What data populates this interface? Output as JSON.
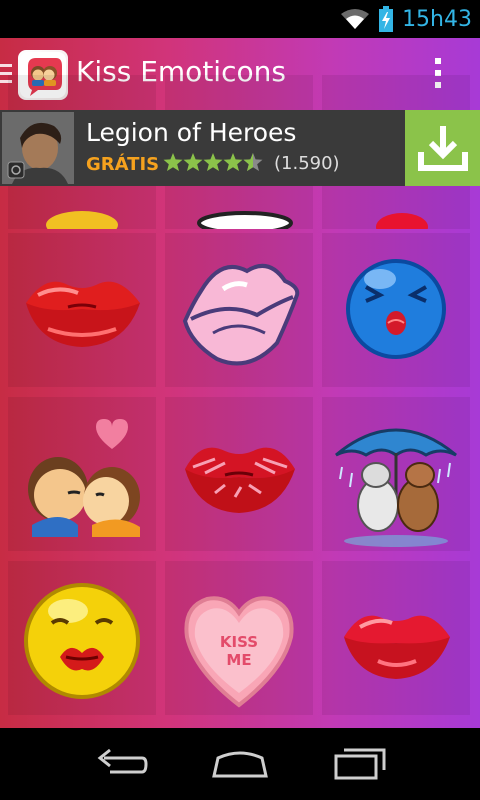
{
  "status_bar": {
    "time": "15h43",
    "icons": [
      "wifi-icon",
      "battery-icon"
    ],
    "time_color": "#33b5e5"
  },
  "app": {
    "title": "Kiss Emoticons",
    "icon": "kiss-app-icon",
    "menu_icon": "overflow-menu-icon",
    "gradient": [
      "#c72c44",
      "#d1347a",
      "#c13ab6",
      "#a73ad6"
    ]
  },
  "ad": {
    "title": "Legion of Heroes",
    "cta": "GRÁTIS",
    "rating": 4.5,
    "rating_count": "(1.590)",
    "download_icon": "download-icon",
    "accent": "#8bc34a",
    "cta_color": "#f6a21e"
  },
  "emoticons": [
    {
      "name": "red-lips-kiss"
    },
    {
      "name": "pink-cartoon-lips"
    },
    {
      "name": "blue-kissing-smiley"
    },
    {
      "name": "kissing-couple"
    },
    {
      "name": "lipstick-kiss-print"
    },
    {
      "name": "bunnies-under-umbrella"
    },
    {
      "name": "yellow-kissing-smiley"
    },
    {
      "name": "kiss-me-candy-heart",
      "text": "KISS ME"
    },
    {
      "name": "red-pouty-lips"
    }
  ],
  "nav": {
    "back_icon": "back-icon",
    "home_icon": "home-icon",
    "recents_icon": "recent-apps-icon"
  }
}
